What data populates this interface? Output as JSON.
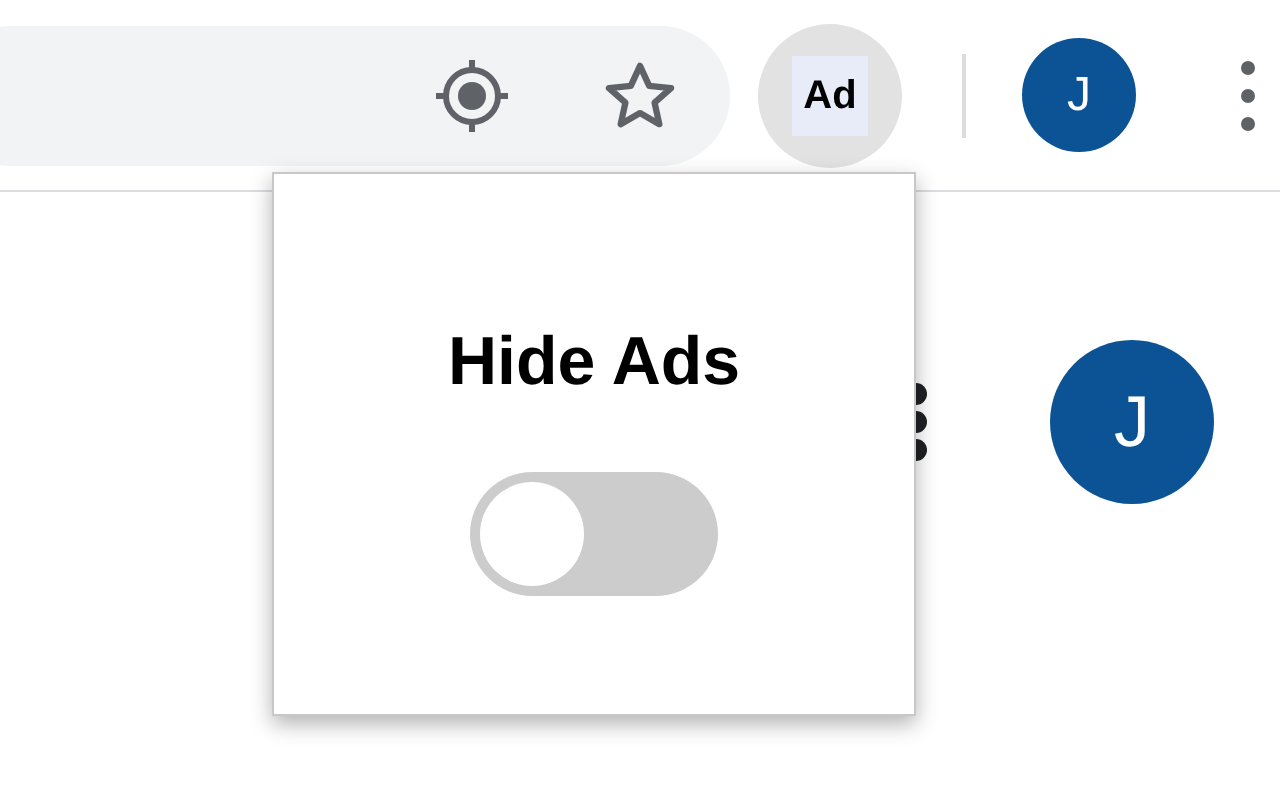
{
  "toolbar": {
    "extension": {
      "label": "Ad"
    },
    "profile": {
      "initial": "J"
    }
  },
  "page": {
    "avatar": {
      "initial": "J"
    }
  },
  "popup": {
    "title": "Hide Ads",
    "toggle": {
      "on": false
    }
  }
}
